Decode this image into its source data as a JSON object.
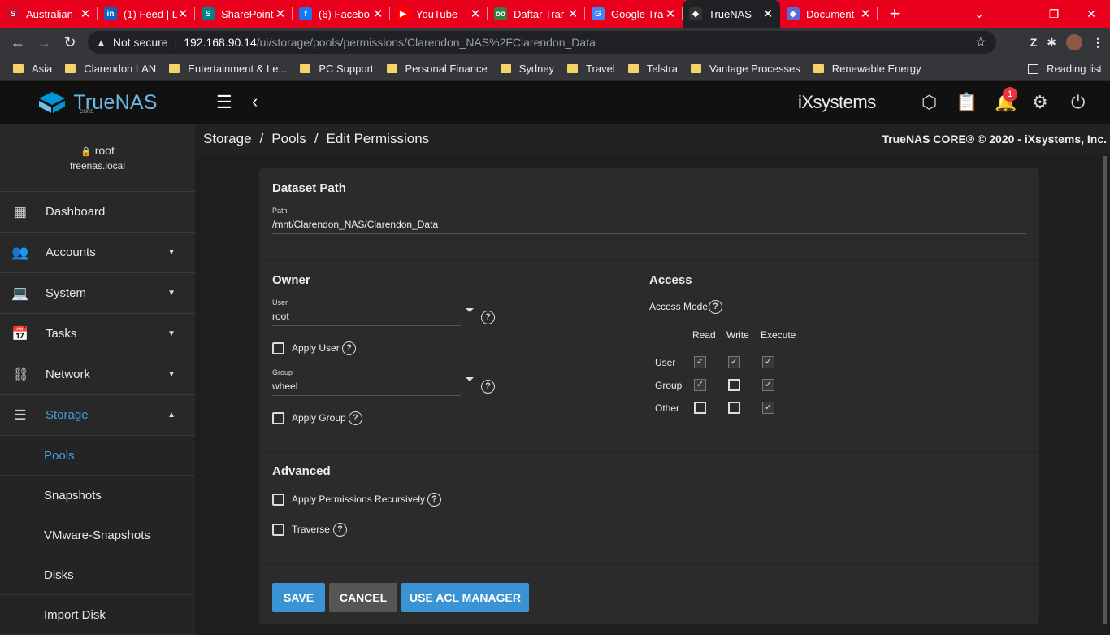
{
  "browser": {
    "tabs": [
      {
        "title": "Australian",
        "fav": "S",
        "color": "#c8102e"
      },
      {
        "title": "(1) Feed | L",
        "fav": "in",
        "color": "#0a66c2"
      },
      {
        "title": "SharePoint",
        "fav": "S",
        "color": "#038387"
      },
      {
        "title": "(6) Facebo",
        "fav": "f",
        "color": "#1877f2"
      },
      {
        "title": "YouTube",
        "fav": "▶",
        "color": "#ff0000"
      },
      {
        "title": "Daftar Trar",
        "fav": "oo",
        "color": "#3a7d44"
      },
      {
        "title": "Google Tra",
        "fav": "G",
        "color": "#4285f4"
      },
      {
        "title": "TrueNAS -",
        "fav": "◆",
        "color": "#333333"
      },
      {
        "title": "Document",
        "fav": "◆",
        "color": "#5b6ad4"
      }
    ],
    "active_tab": 7,
    "not_secure": "Not secure",
    "url_host": "192.168.90.14",
    "url_path": "/ui/storage/pools/permissions/Clarendon_NAS%2FClarendon_Data",
    "bookmarks": [
      "Asia",
      "Clarendon LAN",
      "Entertainment & Le...",
      "PC Support",
      "Personal Finance",
      "Sydney",
      "Travel",
      "Telstra",
      "Vantage Processes",
      "Renewable Energy"
    ],
    "reading_list": "Reading list"
  },
  "app": {
    "logo": "TrueNAS",
    "logo_sub": "CORE",
    "vendor": "iXsystems",
    "notification_count": "1",
    "copyright": "TrueNAS CORE® © 2020 - iXsystems, Inc."
  },
  "sidebar": {
    "user": "root",
    "host": "freenas.local",
    "items": [
      {
        "label": "Dashboard"
      },
      {
        "label": "Accounts"
      },
      {
        "label": "System"
      },
      {
        "label": "Tasks"
      },
      {
        "label": "Network"
      },
      {
        "label": "Storage"
      }
    ],
    "storage_sub": [
      "Pools",
      "Snapshots",
      "VMware-Snapshots",
      "Disks",
      "Import Disk"
    ]
  },
  "breadcrumb": [
    "Storage",
    "Pools",
    "Edit Permissions"
  ],
  "form": {
    "dataset_title": "Dataset Path",
    "path_label": "Path",
    "path_value": "/mnt/Clarendon_NAS/Clarendon_Data",
    "owner_title": "Owner",
    "user_label": "User",
    "user_value": "root",
    "apply_user": "Apply User",
    "group_label": "Group",
    "group_value": "wheel",
    "apply_group": "Apply Group",
    "access_title": "Access",
    "access_mode": "Access Mode",
    "col_read": "Read",
    "col_write": "Write",
    "col_execute": "Execute",
    "rows": [
      {
        "label": "User",
        "read": true,
        "write": true,
        "execute": true
      },
      {
        "label": "Group",
        "read": true,
        "write": false,
        "execute": true
      },
      {
        "label": "Other",
        "read": false,
        "write": false,
        "execute": true
      }
    ],
    "advanced_title": "Advanced",
    "apply_recursive": "Apply Permissions Recursively",
    "traverse": "Traverse",
    "save": "SAVE",
    "cancel": "CANCEL",
    "acl_manager": "USE ACL MANAGER"
  }
}
